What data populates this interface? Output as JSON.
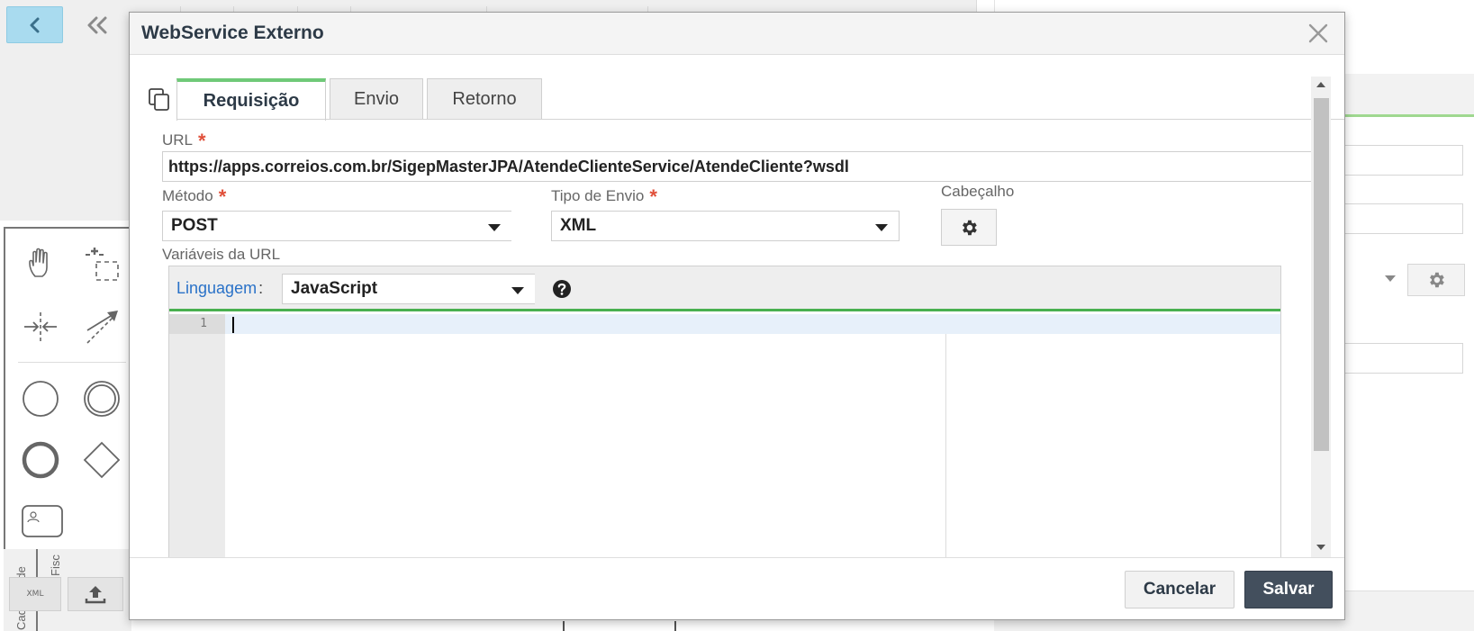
{
  "background": {
    "toolbar": {
      "back_icon": "chevron-left-icon",
      "collapse_icon": "double-chevron-left-icon"
    },
    "palette": {
      "tools": [
        "hand-tool-icon",
        "lasso-tool-icon",
        "space-tool-icon",
        "connect-tool-icon",
        "start-event-icon",
        "intermediate-event-icon",
        "end-event-icon",
        "gateway-icon",
        "task-icon"
      ],
      "vertical_labels": [
        "Cadastro de",
        "Fisc"
      ],
      "xml_button_label": "XML",
      "upload_icon": "upload-icon"
    },
    "right_panel": {
      "gear_icon": "gear-icon"
    }
  },
  "modal": {
    "title": "WebService Externo",
    "close_icon": "close-icon",
    "copy_icon": "copy-icon",
    "tabs": [
      {
        "label": "Requisição",
        "active": true
      },
      {
        "label": "Envio",
        "active": false
      },
      {
        "label": "Retorno",
        "active": false
      }
    ],
    "url": {
      "label": "URL",
      "required_mark": "*",
      "value": "https://apps.correios.com.br/SigepMasterJPA/AtendeClienteService/AtendeCliente?wsdl"
    },
    "metodo": {
      "label": "Método",
      "required_mark": "*",
      "value": "POST"
    },
    "tipo_envio": {
      "label": "Tipo de Envio",
      "required_mark": "*",
      "value": "XML"
    },
    "cabecalho": {
      "label": "Cabeçalho",
      "icon": "gear-icon"
    },
    "variaveis": {
      "label": "Variáveis da URL",
      "linguagem_label": "Linguagem",
      "linguagem_colon": ":",
      "linguagem_value": "JavaScript",
      "help_icon": "help-icon",
      "line_numbers": [
        "1"
      ]
    },
    "footer": {
      "cancel_label": "Cancelar",
      "save_label": "Salvar"
    }
  },
  "colors": {
    "accent_green": "#49b04f",
    "tab_active_green": "#6fc978",
    "required_red": "#e0503a",
    "link_blue": "#2a72c8",
    "save_button": "#434f5d",
    "back_button": "#a9dbef"
  }
}
